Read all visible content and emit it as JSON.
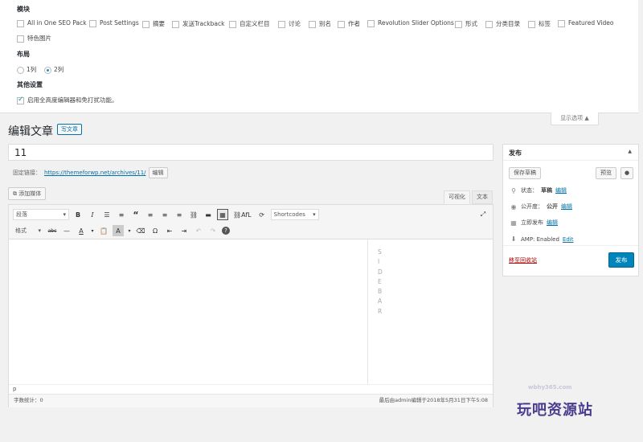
{
  "screen_options": {
    "boxes_heading": "模块",
    "boxes": [
      {
        "label": "All in One SEO Pack",
        "checked": false
      },
      {
        "label": "Post Settings",
        "checked": false
      },
      {
        "label": "摘要",
        "checked": false
      },
      {
        "label": "发送Trackback",
        "checked": false
      },
      {
        "label": "自定义栏目",
        "checked": false
      },
      {
        "label": "讨论",
        "checked": false
      },
      {
        "label": "别名",
        "checked": false
      },
      {
        "label": "作者",
        "checked": false
      },
      {
        "label": "Revolution Slider Options",
        "checked": false
      },
      {
        "label": "形式",
        "checked": false
      },
      {
        "label": "分类目录",
        "checked": false
      },
      {
        "label": "标签",
        "checked": false
      },
      {
        "label": "Featured Video",
        "checked": false
      },
      {
        "label": "特色图片",
        "checked": false
      }
    ],
    "layout_heading": "布局",
    "layout_options": [
      {
        "label": "1列",
        "checked": false
      },
      {
        "label": "2列",
        "checked": true
      }
    ],
    "other_heading": "其他设置",
    "other_option": {
      "label": "启用全高度编辑器和免打扰功能。",
      "checked": true
    },
    "toggle_label": "显示选项 ▲"
  },
  "page": {
    "title": "编辑文章",
    "add_new": "写文章"
  },
  "post": {
    "title_value": "11",
    "permalink_label": "固定链接：",
    "permalink_url": "https://themeforwp.net/archives/11/",
    "permalink_edit": "编辑"
  },
  "editor": {
    "add_media": "添加媒体",
    "tab_visual": "可视化",
    "tab_text": "文本",
    "format_select": "段落",
    "styles_select": "格式",
    "shortcodes_select": "Shortcodes",
    "afl_label": "AfL",
    "sidebar_letters": [
      "S",
      "I",
      "D",
      "E",
      "B",
      "A",
      "R"
    ],
    "path": "p",
    "word_count": "字数统计：0",
    "last_edit": "最后由admin编辑于2018年5月31日下午5:08"
  },
  "publish_box": {
    "title": "发布",
    "save_draft": "保存草稿",
    "preview": "预览",
    "status_label": "状态：",
    "status_value": "草稿",
    "visibility_label": "公开度：",
    "visibility_value": "公开",
    "schedule_label": "立即发布",
    "edit_link": "编辑",
    "amp_label": "AMP: Enabled",
    "amp_edit": "Edit",
    "trash": "移至回收站",
    "publish": "发布"
  },
  "watermark": {
    "url": "wbhy365.com",
    "text": "玩吧资源站"
  },
  "colors": {
    "accent": "#0073aa",
    "primary_button": "#0085ba",
    "trash": "#a00000"
  }
}
